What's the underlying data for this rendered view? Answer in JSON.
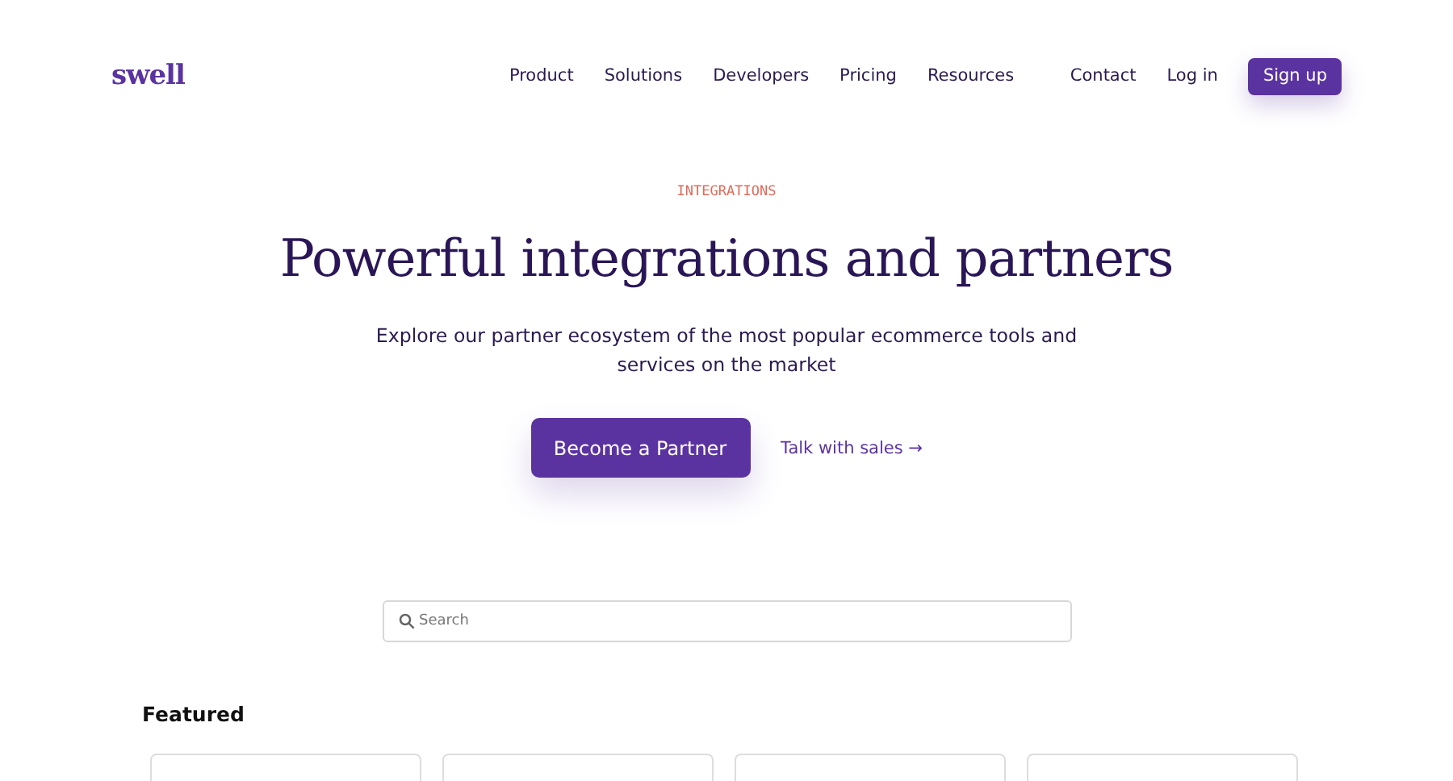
{
  "header": {
    "logo": "swell",
    "nav": [
      "Product",
      "Solutions",
      "Developers",
      "Pricing",
      "Resources"
    ],
    "contact": "Contact",
    "login": "Log in",
    "signup": "Sign up"
  },
  "hero": {
    "eyebrow": "INTEGRATIONS",
    "title": "Powerful integrations and partners",
    "subtitle": "Explore our partner ecosystem of the most popular ecommerce tools and services on the market",
    "primary_button": "Become a Partner",
    "secondary_link": "Talk with sales →"
  },
  "search": {
    "placeholder": "Search"
  },
  "featured": {
    "heading": "Featured"
  }
}
